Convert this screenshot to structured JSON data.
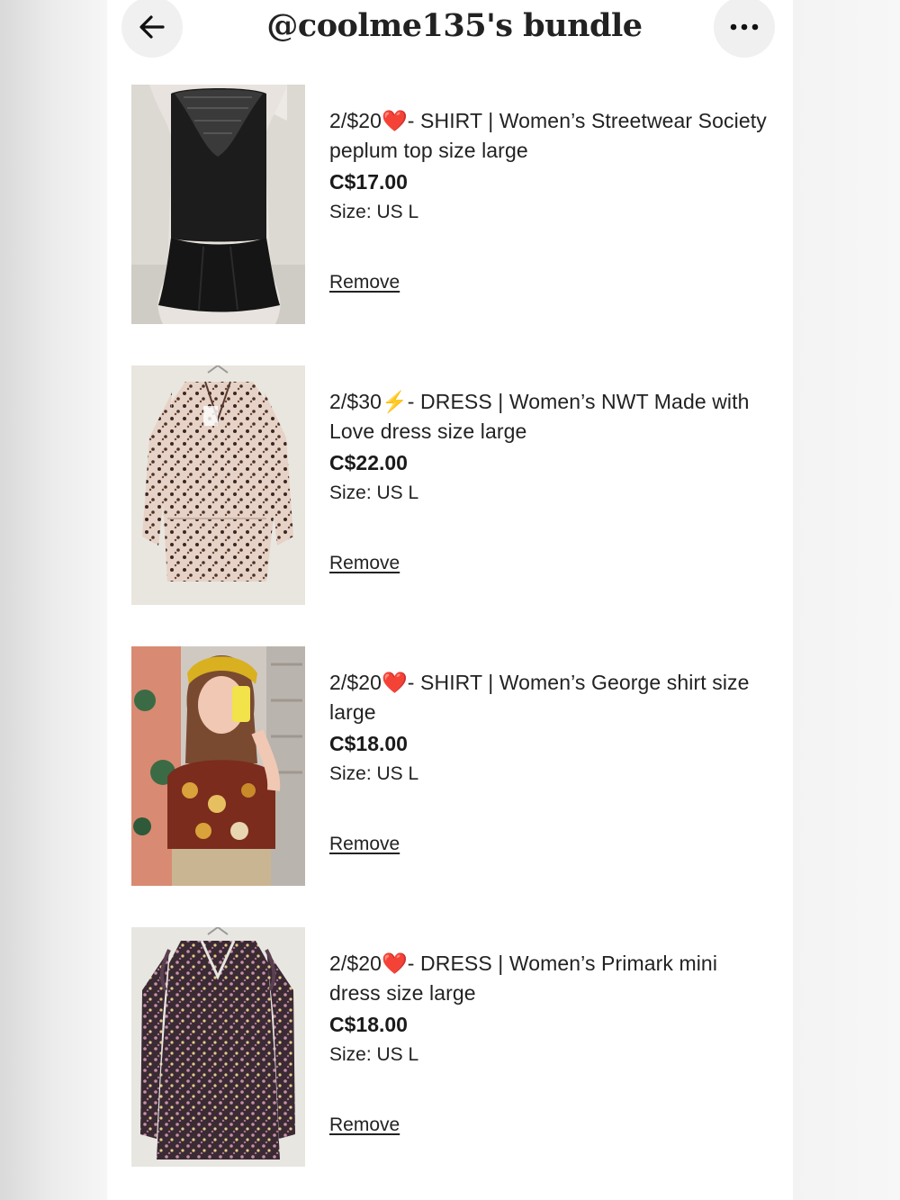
{
  "header": {
    "title": "@coolme135's bundle",
    "back_icon": "arrow-left-icon",
    "more_icon": "more-horizontal-icon"
  },
  "items": [
    {
      "title": "2/$20❤️- SHIRT | Women’s Streetwear Society peplum top size large",
      "price": "C$17.00",
      "size": "Size: US L",
      "remove_label": "Remove"
    },
    {
      "title": "2/$30⚡️- DRESS | Women’s NWT Made with Love dress size large",
      "price": "C$22.00",
      "size": "Size: US L",
      "remove_label": "Remove"
    },
    {
      "title": "2/$20❤️- SHIRT | Women’s George shirt size large",
      "price": "C$18.00",
      "size": "Size: US L",
      "remove_label": "Remove"
    },
    {
      "title": "2/$20❤️- DRESS | Women’s Primark mini dress size large",
      "price": "C$18.00",
      "size": "Size: US L",
      "remove_label": "Remove"
    }
  ]
}
